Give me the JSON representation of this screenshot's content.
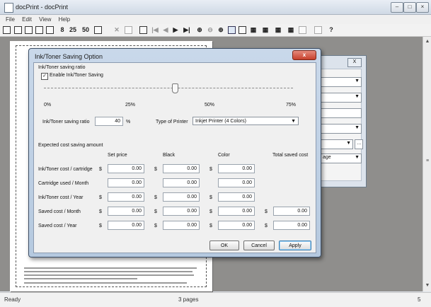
{
  "window": {
    "title": "docPrint - docPrint"
  },
  "menu": [
    "File",
    "Edit",
    "View",
    "Help"
  ],
  "toolbar": {
    "pages_labels": [
      "8",
      "25",
      "50"
    ]
  },
  "status": {
    "left": "Ready",
    "center": "3 pages",
    "right": "5"
  },
  "dialog": {
    "title": "Ink/Toner Saving Option",
    "close_label": "x",
    "ratio_group": "Ink/Toner saving ratio",
    "enable_label": "Enable Ink/Toner Saving",
    "enable_checked": true,
    "slider_value_percent": 40,
    "ticks": [
      "0%",
      "25%",
      "50%",
      "75%"
    ],
    "ratio_label": "Ink/Toner saving ratio",
    "ratio_value": "40",
    "ratio_unit": "%",
    "printer_type_label": "Type of Printer",
    "printer_type_value": "Inkjet Printer (4 Colors)",
    "cost_group": "Expected cost saving amount",
    "columns": {
      "set_price": "Set price",
      "black": "Black",
      "color": "Color",
      "total": "Total saved cost"
    },
    "currency": "$",
    "rows": [
      {
        "label": "Ink/Toner cost / cartridge",
        "set_price": "0.00",
        "black": "0.00",
        "color": "0.00",
        "total": ""
      },
      {
        "label": "Cartridge used / Month",
        "set_price": "0.00",
        "black": "0.00",
        "color": "0.00",
        "total": ""
      },
      {
        "label": "Ink/Toner cost / Year",
        "set_price": "0.00",
        "black": "0.00",
        "color": "0.00",
        "total": ""
      },
      {
        "label": "Saved cost / Month",
        "set_price": "0.00",
        "black": "0.00",
        "color": "0.00",
        "total": "0.00"
      },
      {
        "label": "Saved cost / Year",
        "set_price": "0.00",
        "black": "0.00",
        "color": "0.00",
        "total": "0.00"
      }
    ],
    "buttons": {
      "ok": "OK",
      "cancel": "Cancel",
      "apply": "Apply"
    }
  },
  "back_dialog": {
    "close_label": "X",
    "partial_text": "age"
  },
  "colors": {
    "dialog_frame": "#b5c9df",
    "close_red": "#c7412c",
    "workspace": "#8f8e8c"
  }
}
